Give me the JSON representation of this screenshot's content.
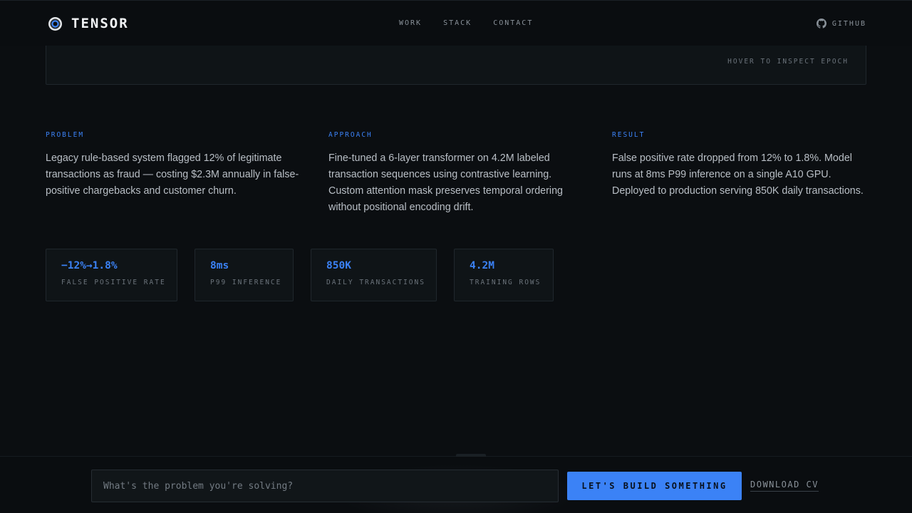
{
  "nav": {
    "brand": "TENSOR",
    "links": [
      "WORK",
      "STACK",
      "CONTACT"
    ],
    "github": "GITHUB"
  },
  "chart_panel": {
    "hint": "HOVER TO INSPECT EPOCH"
  },
  "sections": [
    {
      "label": "PROBLEM",
      "text": "Legacy rule-based system flagged 12% of legitimate transactions as fraud — costing $2.3M annually in false-positive chargebacks and customer churn."
    },
    {
      "label": "APPROACH",
      "text": "Fine-tuned a 6-layer transformer on 4.2M labeled transaction sequences using contrastive learning. Custom attention mask preserves temporal ordering without positional encoding drift."
    },
    {
      "label": "RESULT",
      "text": "False positive rate dropped from 12% to 1.8%. Model runs at 8ms P99 inference on a single A10 GPU. Deployed to production serving 850K daily transactions."
    }
  ],
  "metrics": [
    {
      "value": "−12%→1.8%",
      "label": "FALSE POSITIVE RATE"
    },
    {
      "value": "8ms",
      "label": "P99 INFERENCE"
    },
    {
      "value": "850K",
      "label": "DAILY TRANSACTIONS"
    },
    {
      "value": "4.2M",
      "label": "TRAINING ROWS"
    }
  ],
  "cta": {
    "placeholder": "What's the problem you're solving?",
    "button": "LET'S BUILD SOMETHING",
    "download": "DOWNLOAD CV"
  },
  "colors": {
    "accent": "#3b82f6",
    "background": "#0b0e11"
  }
}
